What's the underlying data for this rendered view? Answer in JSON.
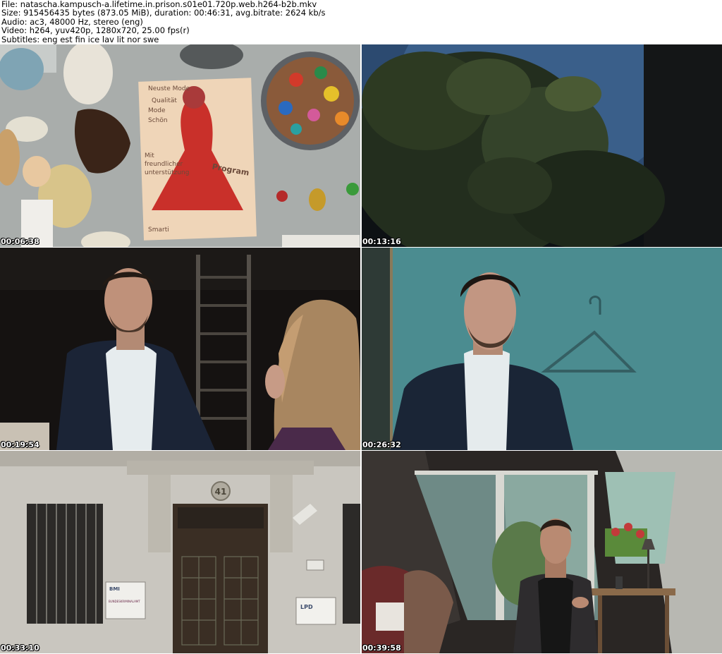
{
  "meta": {
    "file": "File: natascha.kampusch-a.lifetime.in.prison.s01e01.720p.web.h264-b2b.mkv",
    "size": "Size: 915456435 bytes (873.05 MiB), duration: 00:46:31, avg.bitrate: 2624 kb/s",
    "audio": "Audio: ac3, 48000 Hz, stereo (eng)",
    "video": "Video: h264, yuv420p, 1280x720, 25.00 fps(r)",
    "subtitles": "Subtitles: eng est fin ice lav lit nor swe"
  },
  "frames": [
    {
      "timestamp": "00:06:38",
      "drawing_text": [
        "Neuste Mode",
        "Qualität",
        "Mode",
        "Schön",
        "Mit",
        "freundlicher",
        "unterstützung",
        "Program",
        "Smarti"
      ]
    },
    {
      "timestamp": "00:13:16"
    },
    {
      "timestamp": "00:19:54"
    },
    {
      "timestamp": "00:26:32"
    },
    {
      "timestamp": "00:33:10",
      "sign_text": [
        "BMI",
        "BUNDESKRIMINALAMT",
        "LPD"
      ],
      "house_number": "41"
    },
    {
      "timestamp": "00:39:58"
    }
  ]
}
